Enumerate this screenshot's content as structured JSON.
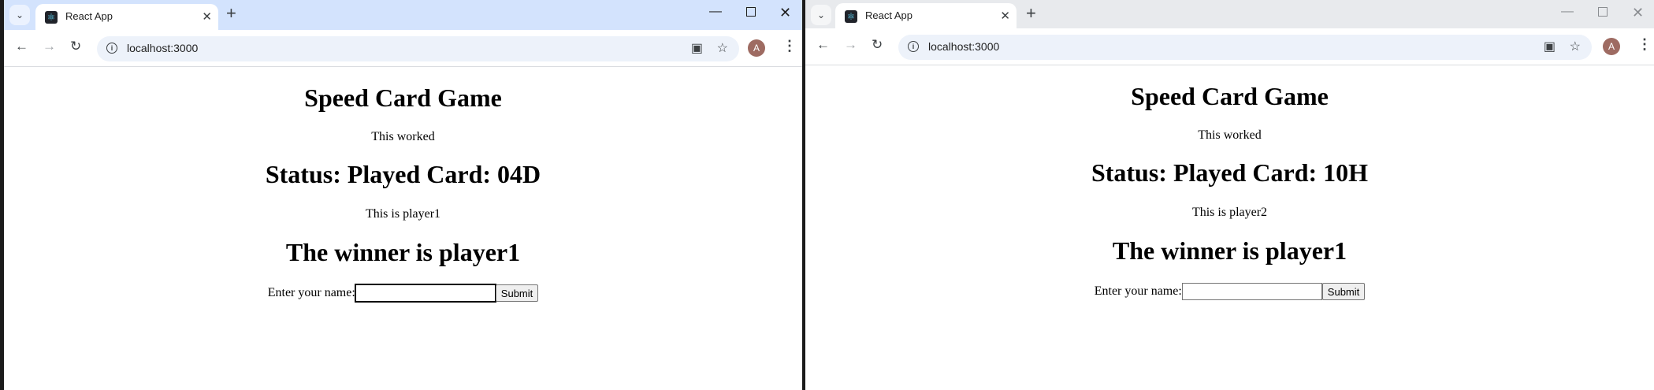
{
  "windows": [
    {
      "tab_title": "React App",
      "url": "localhost:3000",
      "avatar": "A",
      "page": {
        "title": "Speed Card Game",
        "message": "This worked",
        "status": "Status: Played Card: 04D",
        "player": "This is player1",
        "winner": "The winner is player1",
        "name_label": "Enter your name:",
        "name_value": "",
        "submit_label": "Submit"
      }
    },
    {
      "tab_title": "React App",
      "url": "localhost:3000",
      "avatar": "A",
      "page": {
        "title": "Speed Card Game",
        "message": "This worked",
        "status": "Status: Played Card: 10H",
        "player": "This is player2",
        "winner": "The winner is player1",
        "name_label": "Enter your name:",
        "name_value": "",
        "submit_label": "Submit"
      }
    }
  ],
  "icons": {
    "tab_search": "chevron-down-icon",
    "tab_close": "close-icon",
    "new_tab": "plus-icon",
    "minimize": "minimize-icon",
    "maximize": "maximize-icon",
    "close_window": "close-icon",
    "back": "arrow-left-icon",
    "forward": "arrow-right-icon",
    "reload": "reload-icon",
    "site_info": "info-icon",
    "install": "install-app-icon",
    "bookmark": "star-icon",
    "menu": "kebab-menu-icon"
  },
  "colors": {
    "active_tabstrip": "#d3e3fd",
    "inactive_tabstrip": "#e8eaed",
    "omnibox": "#edf2fa",
    "avatar": "#9e6b62"
  }
}
